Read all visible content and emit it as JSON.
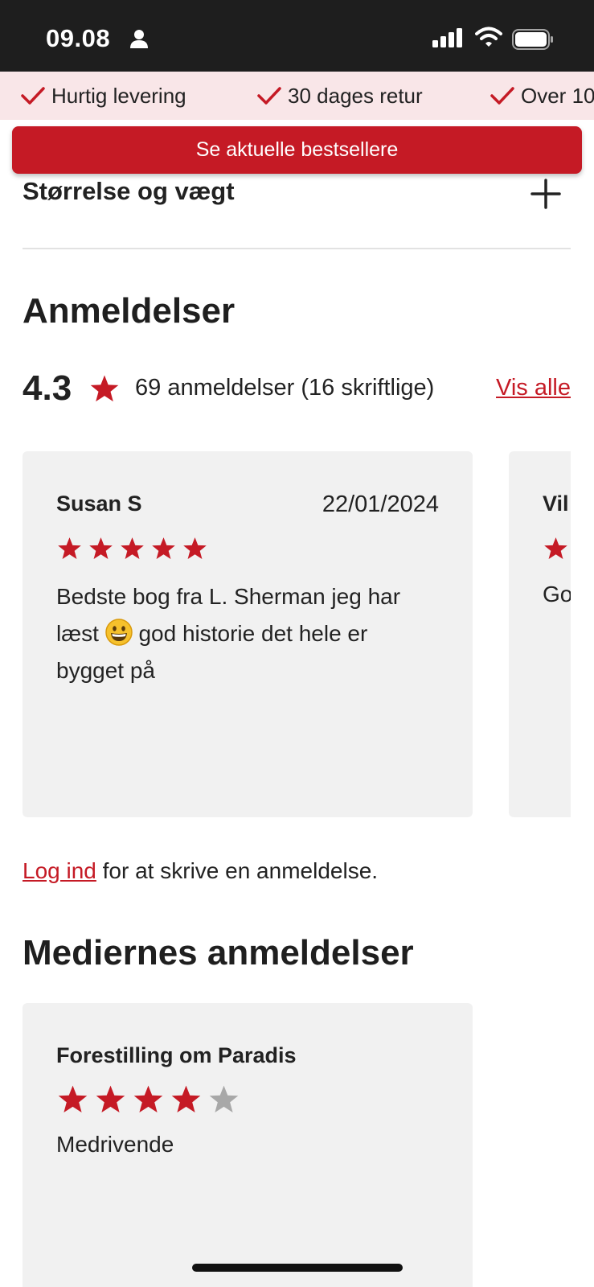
{
  "status_bar": {
    "time": "09.08"
  },
  "usp": {
    "items": [
      "Hurtig levering",
      "30 dages retur",
      "Over 10"
    ]
  },
  "cta": {
    "label": "Se aktuelle bestsellere"
  },
  "accordion": {
    "title": "Størrelse og vægt"
  },
  "reviews": {
    "title": "Anmeldelser",
    "rating": "4.3",
    "count_text": "69 anmeldelser (16 skriftlige)",
    "show_all_label": "Vis alle",
    "cards": [
      {
        "name": "Susan S",
        "date": "22/01/2024",
        "stars": 5,
        "text_before_emoji": "Bedste bog fra L. Sherman jeg har læst",
        "text_after_emoji": "god historie det hele er bygget på"
      },
      {
        "name": "Vil",
        "stars": 1,
        "text": "Go"
      }
    ],
    "login_link_label": "Log ind",
    "login_suffix": " for at skrive en anmeldelse."
  },
  "media_reviews": {
    "title": "Mediernes anmeldelser",
    "cards": [
      {
        "title": "Forestilling om Paradis",
        "stars": 4,
        "max_stars": 5,
        "text": "Medrivende"
      }
    ]
  },
  "colors": {
    "accent": "#c51a25",
    "card_bg": "#f1f1f1",
    "usp_bg": "#f9e6e8",
    "star_empty": "#a8a8a8"
  },
  "icons": [
    "person-icon",
    "signal-icon",
    "wifi-icon",
    "battery-icon",
    "check-icon",
    "plus-icon",
    "star-icon",
    "grinning-face-emoji"
  ]
}
